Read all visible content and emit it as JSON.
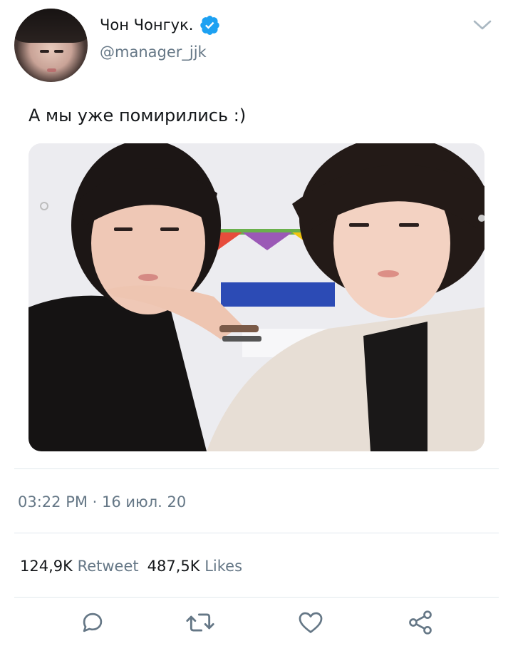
{
  "user": {
    "display_name": "Чон Чонгук.",
    "handle": "@manager_jjk",
    "verified": true,
    "avatar_icon": "profile-avatar"
  },
  "tweet": {
    "text": "А мы уже помирились :)",
    "image_icon": "photo-two-people-selfie"
  },
  "meta": {
    "timestamp": "03:22 PM · 16 июл. 20"
  },
  "stats": {
    "retweets_count": "124,9K",
    "retweets_label": "Retweet",
    "likes_count": "487,5K",
    "likes_label": "Likes"
  },
  "actions": {
    "reply_icon": "reply-icon",
    "retweet_icon": "retweet-icon",
    "like_icon": "heart-icon",
    "share_icon": "share-icon"
  },
  "colors": {
    "verified_blue": "#1da1f2",
    "muted_gray": "#657786",
    "text": "#14171a",
    "divider": "#e1e8ed"
  }
}
